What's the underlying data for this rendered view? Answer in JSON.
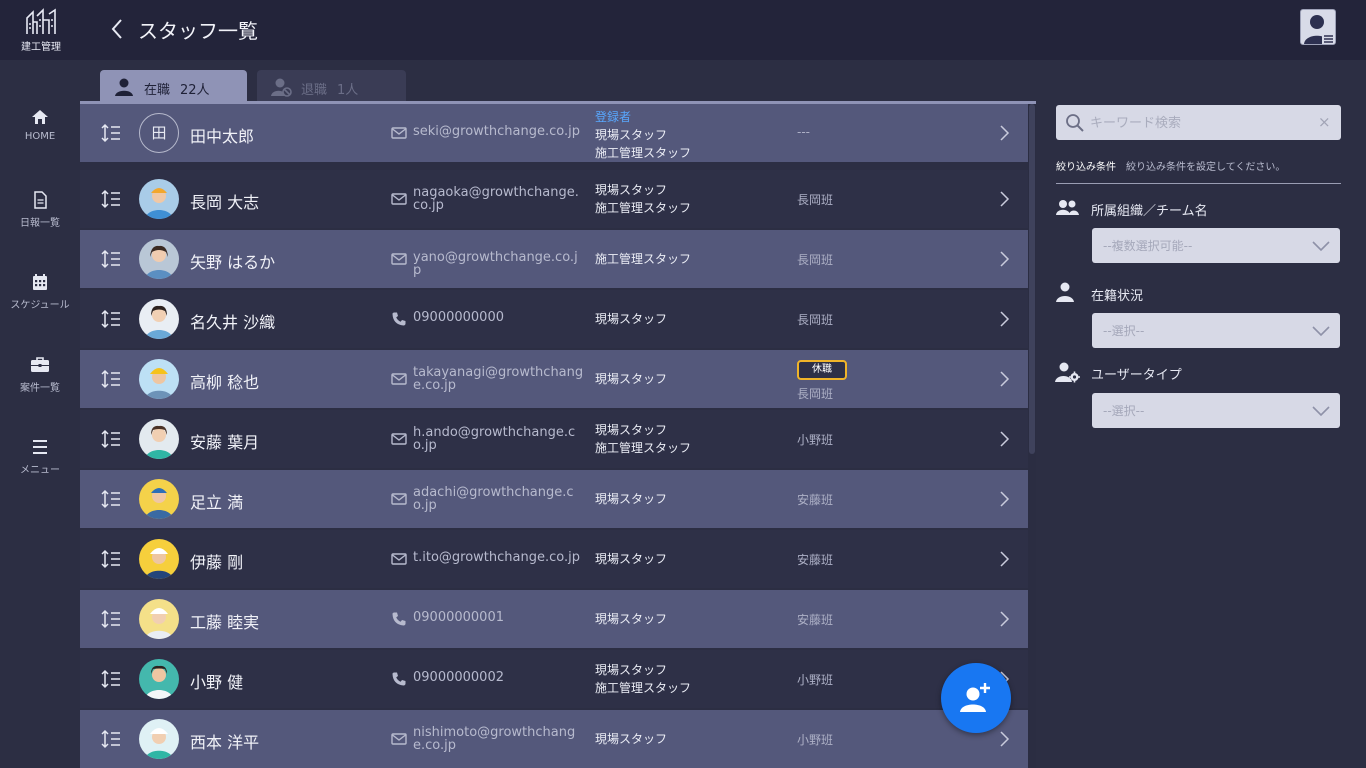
{
  "app": {
    "logo_label": "建工管理",
    "title": "スタッフ一覧"
  },
  "sidebar": {
    "items": [
      {
        "label": "HOME",
        "icon": "home-icon"
      },
      {
        "label": "日報一覧",
        "icon": "document-icon"
      },
      {
        "label": "スケジュール",
        "icon": "calendar-icon"
      },
      {
        "label": "案件一覧",
        "icon": "briefcase-icon"
      },
      {
        "label": "メニュー",
        "icon": "menu-icon"
      }
    ]
  },
  "tabs": [
    {
      "label": "在職",
      "count": "22人"
    },
    {
      "label": "退職",
      "count": "1人"
    }
  ],
  "staff": [
    {
      "initial": "田",
      "name": "田中太郎",
      "contact_type": "email",
      "contact": "seki@growthchange.co.jp",
      "registrant": "登録者",
      "roles": [
        "現場スタッフ",
        "施工管理スタッフ"
      ],
      "team": "---"
    },
    {
      "name": "長岡 大志",
      "contact_type": "email",
      "contact": "nagaoka@growthchange.co.jp",
      "roles": [
        "現場スタッフ",
        "施工管理スタッフ"
      ],
      "team": "長岡班"
    },
    {
      "name": "矢野 はるか",
      "contact_type": "email",
      "contact": "yano@growthchange.co.jp",
      "roles": [
        "施工管理スタッフ"
      ],
      "team": "長岡班"
    },
    {
      "name": "名久井 沙織",
      "contact_type": "phone",
      "contact": "09000000000",
      "roles": [
        "現場スタッフ"
      ],
      "team": "長岡班"
    },
    {
      "name": "高柳 稔也",
      "contact_type": "email",
      "contact": "takayanagi@growthchange.co.jp",
      "roles": [
        "現場スタッフ"
      ],
      "badge": "休職",
      "team": "長岡班"
    },
    {
      "name": "安藤 葉月",
      "contact_type": "email",
      "contact": "h.ando@growthchange.co.jp",
      "roles": [
        "現場スタッフ",
        "施工管理スタッフ"
      ],
      "team": "小野班"
    },
    {
      "name": "足立 満",
      "contact_type": "email",
      "contact": "adachi@growthchange.co.jp",
      "roles": [
        "現場スタッフ"
      ],
      "team": "安藤班"
    },
    {
      "name": "伊藤 剛",
      "contact_type": "email",
      "contact": "t.ito@growthchange.co.jp",
      "roles": [
        "現場スタッフ"
      ],
      "team": "安藤班"
    },
    {
      "name": "工藤 睦実",
      "contact_type": "phone",
      "contact": "09000000001",
      "roles": [
        "現場スタッフ"
      ],
      "team": "安藤班"
    },
    {
      "name": "小野 健",
      "contact_type": "phone",
      "contact": "09000000002",
      "roles": [
        "現場スタッフ",
        "施工管理スタッフ"
      ],
      "team": "小野班"
    },
    {
      "name": "西本 洋平",
      "contact_type": "email",
      "contact": "nishimoto@growthchange.co.jp",
      "roles": [
        "現場スタッフ"
      ],
      "team": "小野班"
    }
  ],
  "filters": {
    "search_placeholder": "キーワード検索",
    "clear": "×",
    "heading": "絞り込み条件",
    "description": "絞り込み条件を設定してください。",
    "org": {
      "label": "所属組織／チーム名",
      "value": "--複数選択可能--"
    },
    "status": {
      "label": "在籍状況",
      "value": "--選択--"
    },
    "user_type": {
      "label": "ユーザータイプ",
      "value": "--選択--"
    }
  },
  "colors": {
    "accent": "#1877f2",
    "registrant": "#58a8ff",
    "leave_badge": "#f0b429",
    "row_odd": "#54587b",
    "row_even": "#2e3047"
  }
}
